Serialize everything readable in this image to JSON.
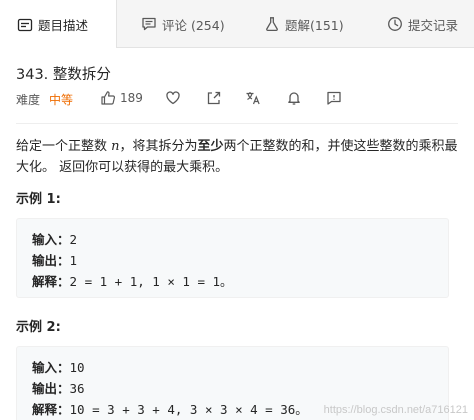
{
  "tabs": [
    {
      "label": "题目描述",
      "icon": "description-icon",
      "active": true
    },
    {
      "label": "评论 (254)",
      "icon": "comment-icon",
      "active": false
    },
    {
      "label": "题解(151)",
      "icon": "flask-icon",
      "active": false
    },
    {
      "label": "提交记录",
      "icon": "history-icon",
      "active": false
    }
  ],
  "problem": {
    "title": "343. 整数拆分",
    "difficulty_label": "难度",
    "difficulty": "中等",
    "likes": "189"
  },
  "description": {
    "p1": "给定一个正整数 ",
    "var": "n",
    "p2": "，将其拆分为",
    "bold": "至少",
    "p3": "两个正整数的和，并使这些整数的乘积最大化。 返回你可以获得的最大乘积。"
  },
  "examples": [
    {
      "title": "示例 1:",
      "lines": [
        {
          "key": "输入：",
          "value": "2"
        },
        {
          "key": "输出：",
          "value": "1"
        },
        {
          "key": "解释：",
          "value": "2 = 1 + 1, 1 × 1 = 1。"
        }
      ]
    },
    {
      "title": "示例 2:",
      "lines": [
        {
          "key": "输入：",
          "value": "10"
        },
        {
          "key": "输出：",
          "value": "36"
        },
        {
          "key": "解释：",
          "value": "10 = 3 + 3 + 4, 3 × 3 × 4 = 36。"
        }
      ]
    }
  ],
  "watermark": "https://blog.csdn.net/a716121",
  "colors": {
    "difficulty_medium": "#ef6c00",
    "example_bg": "#f7f9fa"
  }
}
